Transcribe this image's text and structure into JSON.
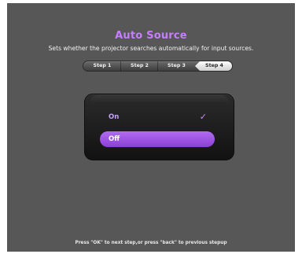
{
  "header": {
    "title": "Auto Source",
    "subtitle": "Sets whether the projector searches automatically for input sources."
  },
  "steps": {
    "items": [
      "Step 1",
      "Step 2",
      "Step 3",
      "Step 4"
    ],
    "current": "Step 4"
  },
  "options": {
    "on_label": "On",
    "off_label": "Off",
    "checked": "On",
    "highlighted": "Off",
    "check_glyph": "✓"
  },
  "footer": {
    "hint": "Press \"OK\" to next step,or press \"back\" to previous stepup"
  },
  "colors": {
    "accent": "#c77dff",
    "panel_bg": "#575757",
    "highlight": "#a35ae6"
  }
}
